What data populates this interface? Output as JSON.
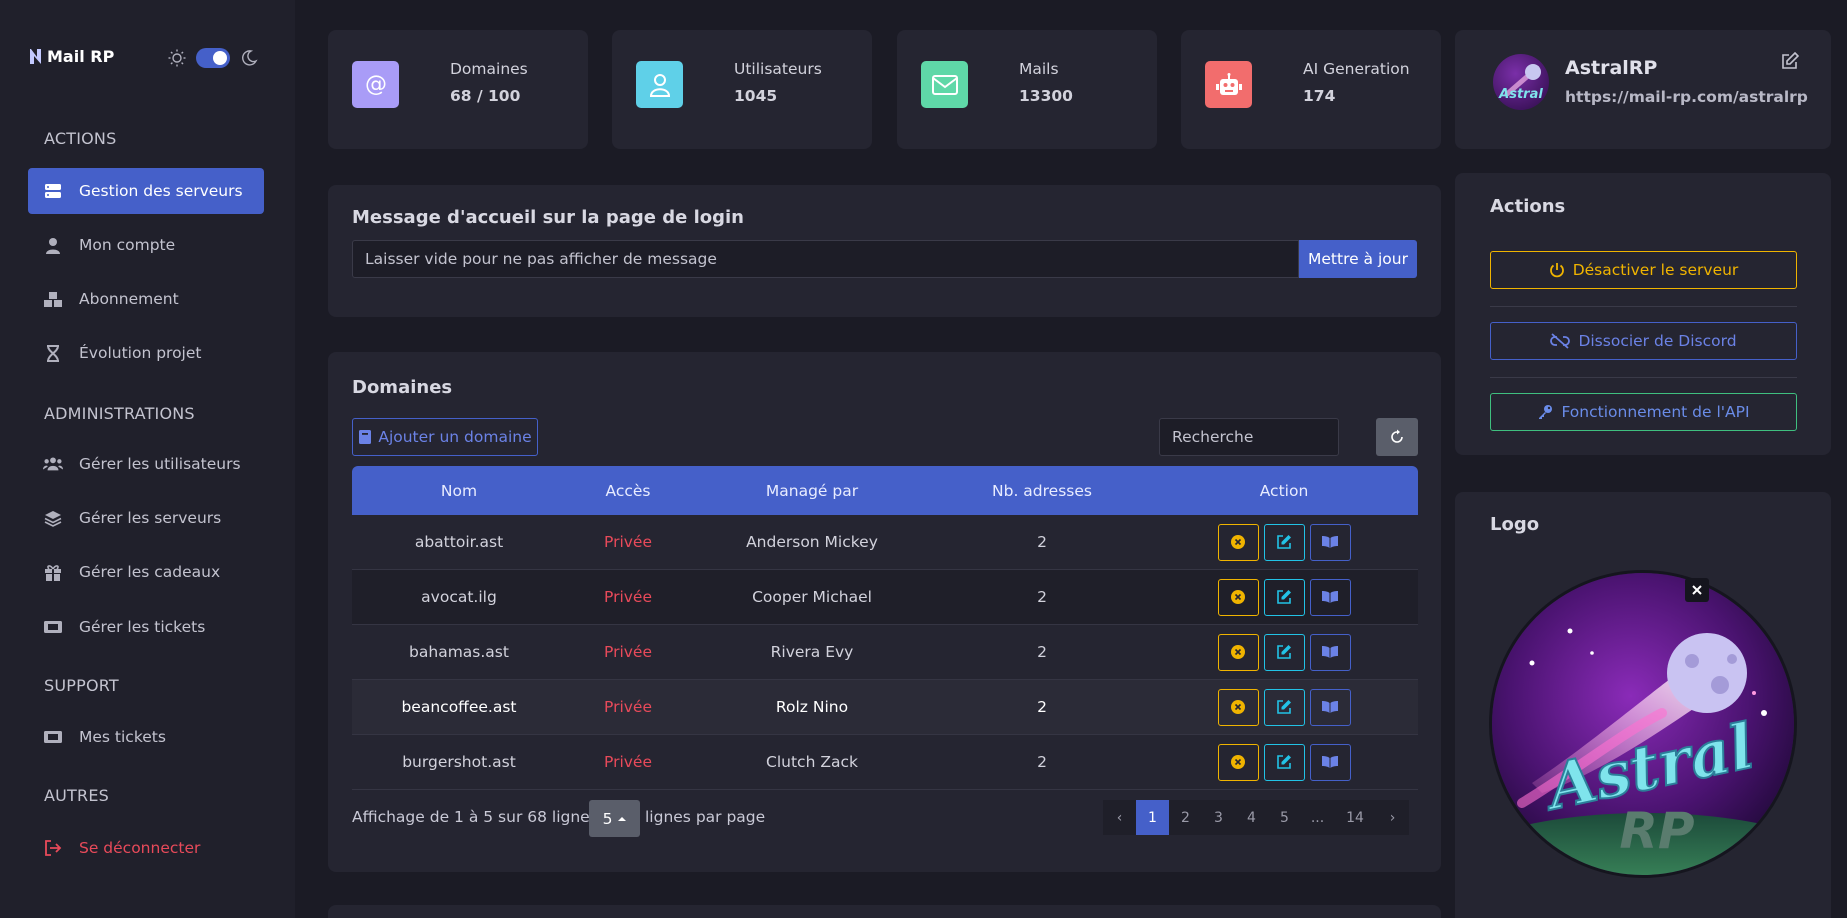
{
  "brand": {
    "name": "Mail RP"
  },
  "sidebar": {
    "sections": [
      "ACTIONS",
      "ADMINISTRATIONS",
      "SUPPORT",
      "AUTRES"
    ],
    "items": [
      {
        "label": "Gestion des serveurs",
        "icon": "server-icon"
      },
      {
        "label": "Mon compte",
        "icon": "user-icon"
      },
      {
        "label": "Abonnement",
        "icon": "boxes-icon"
      },
      {
        "label": "Évolution projet",
        "icon": "hourglass-icon"
      },
      {
        "label": "Gérer les utilisateurs",
        "icon": "users-icon"
      },
      {
        "label": "Gérer les serveurs",
        "icon": "layers-icon"
      },
      {
        "label": "Gérer les cadeaux",
        "icon": "gift-icon"
      },
      {
        "label": "Gérer les tickets",
        "icon": "ticket-icon"
      },
      {
        "label": "Mes tickets",
        "icon": "ticket-icon"
      },
      {
        "label": "Se déconnecter",
        "icon": "logout-icon"
      }
    ]
  },
  "stats": [
    {
      "label": "Domaines",
      "value": "68 / 100",
      "color": "#a99cf7"
    },
    {
      "label": "Utilisateurs",
      "value": "1045",
      "color": "#5fd0e8"
    },
    {
      "label": "Mails",
      "value": "13300",
      "color": "#5fd8a8"
    },
    {
      "label": "AI Generation",
      "value": "174",
      "color": "#f26d6d"
    }
  ],
  "profile": {
    "name": "AstralRP",
    "url": "https://mail-rp.com/astralrp"
  },
  "login_message": {
    "title": "Message d'accueil sur la page de login",
    "placeholder": "Laisser vide pour ne pas afficher de message",
    "button": "Mettre à jour"
  },
  "domains": {
    "title": "Domaines",
    "add_button": "Ajouter un domaine",
    "search_placeholder": "Recherche",
    "columns": [
      "Nom",
      "Accès",
      "Managé par",
      "Nb. adresses",
      "Action"
    ],
    "rows": [
      {
        "name": "abattoir.ast",
        "access": "Privée",
        "manager": "Anderson Mickey",
        "count": "2"
      },
      {
        "name": "avocat.ilg",
        "access": "Privée",
        "manager": "Cooper Michael",
        "count": "2"
      },
      {
        "name": "bahamas.ast",
        "access": "Privée",
        "manager": "Rivera Evy",
        "count": "2"
      },
      {
        "name": "beancoffee.ast",
        "access": "Privée",
        "manager": "Rolz Nino",
        "count": "2"
      },
      {
        "name": "burgershot.ast",
        "access": "Privée",
        "manager": "Clutch Zack",
        "count": "2"
      }
    ],
    "footer": {
      "showing": "Affichage de 1 à 5 sur 68 lignes",
      "per_page": "5",
      "per_page_label": "lignes par page"
    },
    "pagination": [
      "‹",
      "1",
      "2",
      "3",
      "4",
      "5",
      "...",
      "14",
      "›"
    ]
  },
  "actions_panel": {
    "title": "Actions",
    "deactivate": "Désactiver le serveur",
    "unlink": "Dissocier de Discord",
    "api": "Fonctionnement de l'API"
  },
  "logo_panel": {
    "title": "Logo",
    "logo_text_1": "Astral",
    "logo_text_2": "RP"
  },
  "colors": {
    "accent": "#4560c9",
    "danger": "#e84a5a",
    "warning": "#f0b400",
    "success": "#3fbf7f",
    "info": "#22c3e6"
  }
}
